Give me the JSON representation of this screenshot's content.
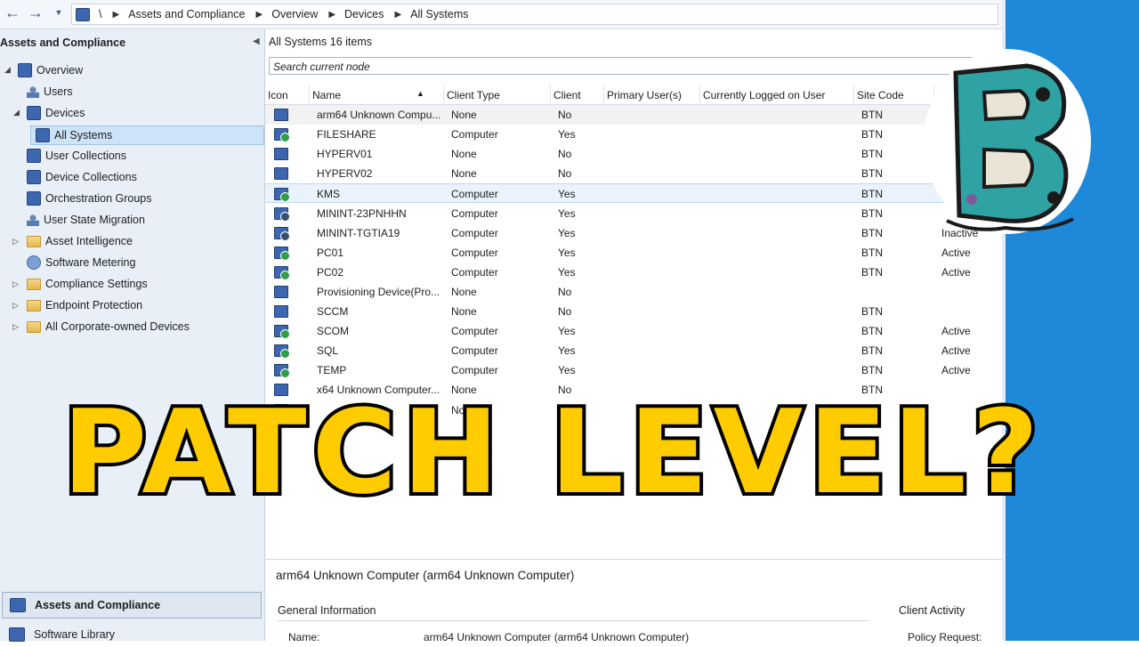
{
  "breadcrumb": {
    "root": "\\",
    "items": [
      "Assets and Compliance",
      "Overview",
      "Devices",
      "All Systems"
    ]
  },
  "left_panel": {
    "title": "Assets and Compliance",
    "tree": [
      {
        "label": "Overview"
      },
      {
        "label": "Users"
      },
      {
        "label": "Devices"
      },
      {
        "label": "All Systems"
      },
      {
        "label": "User Collections"
      },
      {
        "label": "Device Collections"
      },
      {
        "label": "Orchestration Groups"
      },
      {
        "label": "User State Migration"
      },
      {
        "label": "Asset Intelligence"
      },
      {
        "label": "Software Metering"
      },
      {
        "label": "Compliance Settings"
      },
      {
        "label": "Endpoint Protection"
      },
      {
        "label": "All Corporate-owned Devices"
      }
    ],
    "workspaces": [
      "Assets and Compliance",
      "Software Library"
    ]
  },
  "main": {
    "title": "All Systems 16 items",
    "search_placeholder": "Search current node",
    "columns": [
      "Icon",
      "Name",
      "Client Type",
      "Client",
      "Primary User(s)",
      "Currently Logged on User",
      "Site Code"
    ],
    "rows": [
      {
        "name": "arm64 Unknown Compu...",
        "client_type": "None",
        "client": "No",
        "site": "BTN",
        "activity": "",
        "icon": "unknown"
      },
      {
        "name": "FILESHARE",
        "client_type": "Computer",
        "client": "Yes",
        "site": "BTN",
        "activity": "",
        "icon": "ok"
      },
      {
        "name": "HYPERV01",
        "client_type": "None",
        "client": "No",
        "site": "BTN",
        "activity": "",
        "icon": "unknown"
      },
      {
        "name": "HYPERV02",
        "client_type": "None",
        "client": "No",
        "site": "BTN",
        "activity": "",
        "icon": "unknown"
      },
      {
        "name": "KMS",
        "client_type": "Computer",
        "client": "Yes",
        "site": "BTN",
        "activity": "",
        "icon": "ok"
      },
      {
        "name": "MININT-23PNHHN",
        "client_type": "Computer",
        "client": "Yes",
        "site": "BTN",
        "activity": "",
        "icon": "inactive"
      },
      {
        "name": "MININT-TGTIA19",
        "client_type": "Computer",
        "client": "Yes",
        "site": "BTN",
        "activity": "Inactive",
        "icon": "inactive"
      },
      {
        "name": "PC01",
        "client_type": "Computer",
        "client": "Yes",
        "site": "BTN",
        "activity": "Active",
        "icon": "ok"
      },
      {
        "name": "PC02",
        "client_type": "Computer",
        "client": "Yes",
        "site": "BTN",
        "activity": "Active",
        "icon": "ok"
      },
      {
        "name": "Provisioning Device(Pro...",
        "client_type": "None",
        "client": "No",
        "site": "",
        "activity": "",
        "icon": "unknown"
      },
      {
        "name": "SCCM",
        "client_type": "None",
        "client": "No",
        "site": "BTN",
        "activity": "",
        "icon": "unknown"
      },
      {
        "name": "SCOM",
        "client_type": "Computer",
        "client": "Yes",
        "site": "BTN",
        "activity": "Active",
        "icon": "ok"
      },
      {
        "name": "SQL",
        "client_type": "Computer",
        "client": "Yes",
        "site": "BTN",
        "activity": "Active",
        "icon": "ok"
      },
      {
        "name": "TEMP",
        "client_type": "Computer",
        "client": "Yes",
        "site": "BTN",
        "activity": "Active",
        "icon": "ok"
      },
      {
        "name": "x64 Unknown Computer...",
        "client_type": "None",
        "client": "No",
        "site": "BTN",
        "activity": "",
        "icon": "unknown"
      },
      {
        "name": "",
        "client_type": "None",
        "client": "No",
        "site": "",
        "activity": "",
        "icon": "unknown"
      }
    ]
  },
  "details": {
    "title": "arm64 Unknown Computer (arm64 Unknown Computer)",
    "general_section": "General Information",
    "activity_section": "Client Activity",
    "name_label": "Name:",
    "name_value": "arm64 Unknown Computer (arm64 Unknown Computer)",
    "policy_label": "Policy Request:"
  },
  "overlay": {
    "text": "PATCH LEVEL?"
  },
  "colors": {
    "accent_blue": "#1e88d9",
    "overlay_yellow": "#ffcc00",
    "selection": "#cde3f8"
  }
}
